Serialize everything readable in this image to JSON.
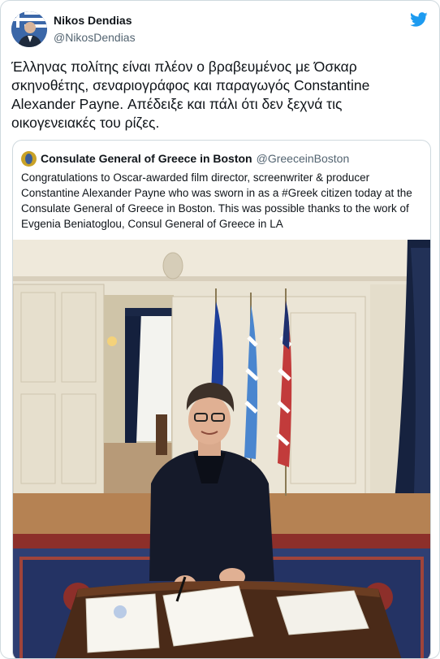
{
  "author": {
    "name": "Nikos Dendias",
    "handle": "@NikosDendias"
  },
  "tweet": {
    "text": "Έλληνας πολίτης είναι πλέον ο βραβευμένος με Όσκαρ σκηνοθέτης, σεναριογράφος και παραγωγός Constantine Alexander Payne. Απέδειξε και πάλι ότι δεν ξεχνά τις οικογενειακές του ρίζες."
  },
  "quoted": {
    "name": "Consulate General of Greece in Boston",
    "handle": "@GreeceinBoston",
    "text": "Congratulations to Oscar-awarded film director, screenwriter & producer Constantine Alexander Payne who was sworn in as a #Greek citizen today at the Consulate General of Greece in Boston. This was possible thanks to the work of Evgenia Beniatoglou, Consul General of Greece in LA"
  },
  "icons": {
    "brand": "twitter-bird-icon"
  },
  "colors": {
    "brand": "#1d9bf0",
    "muted": "#536471",
    "border": "#cfd9de"
  }
}
